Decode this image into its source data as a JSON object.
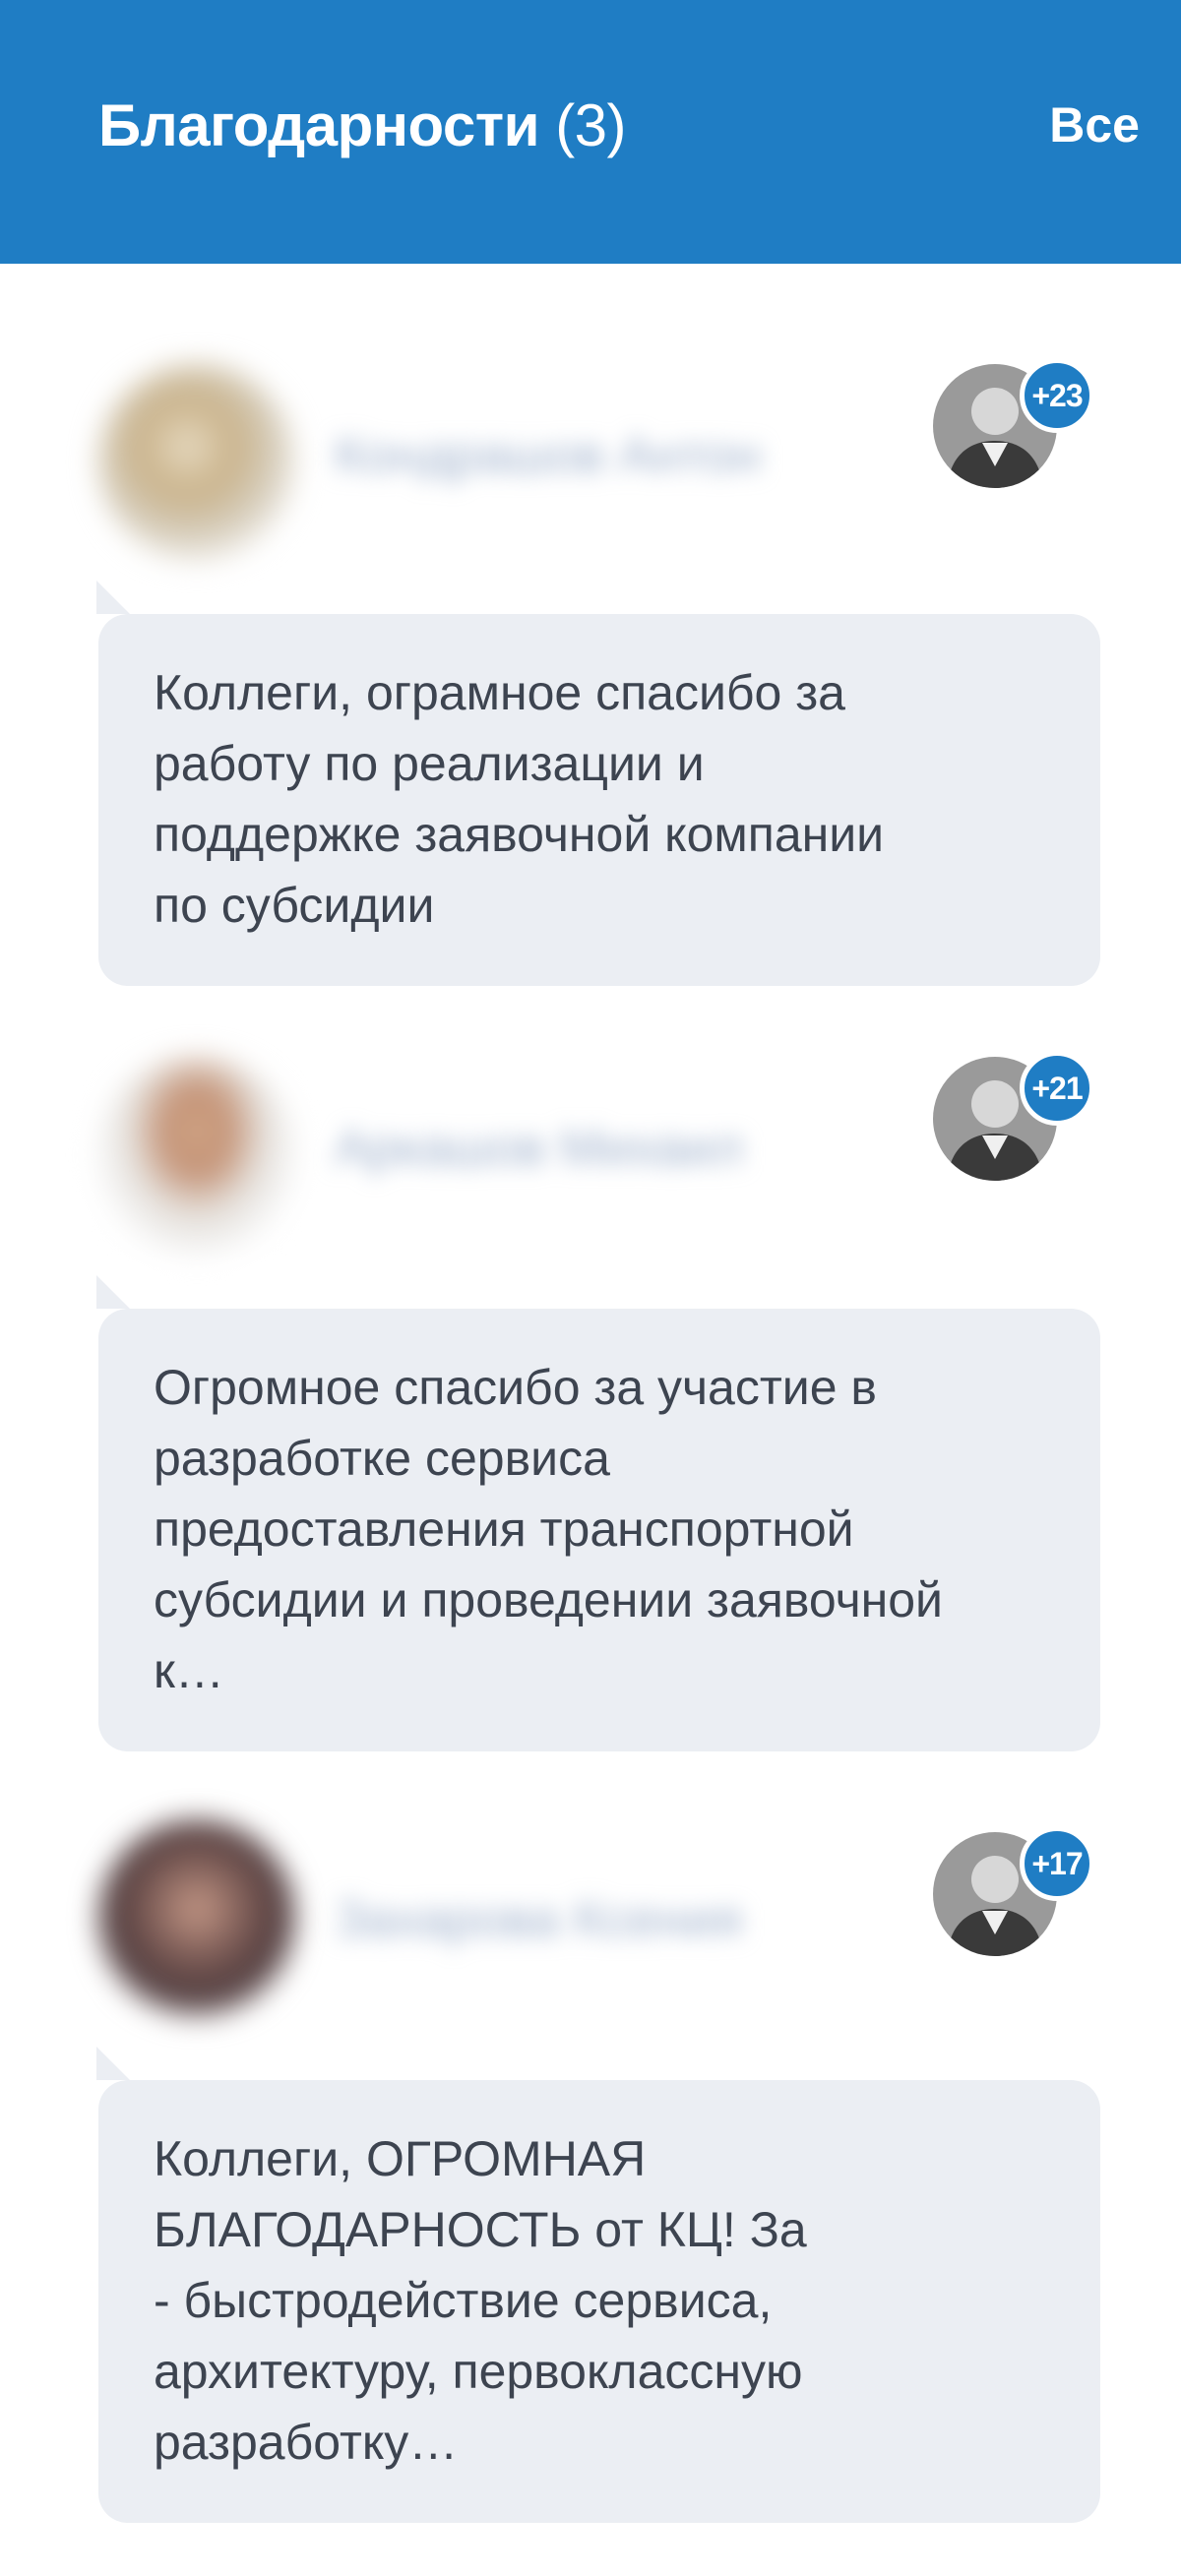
{
  "header": {
    "title": "Благодарности",
    "count": "(3)",
    "all_link": "Все",
    "color": "#1f7dc4"
  },
  "thanks": [
    {
      "author_name": "Кондрашов Антон",
      "giver_count": "+23",
      "message": "Коллеги, ограмное спасибо за\nработу по реализации и\nподдержке заявочной компании\nпо субсидии"
    },
    {
      "author_name": "Аркашов Михаил",
      "giver_count": "+21",
      "message": "Огромное спасибо за участие в\nразработке сервиса\nпредоставления транспортной\nсубсидии и проведении заявочной\nк…"
    },
    {
      "author_name": "Захарова Ксения",
      "giver_count": "+17",
      "message": "Коллеги, ОГРОМНАЯ\nБЛАГОДАРНОСТЬ от КЦ! За\n- быстродействие сервиса,\nархитектуру, первоклассную\nразработку…"
    }
  ]
}
